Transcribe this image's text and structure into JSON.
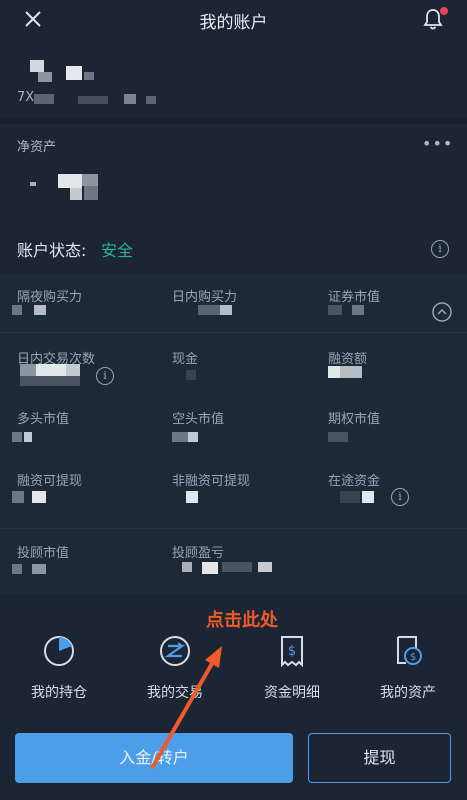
{
  "header": {
    "title": "我的账户",
    "close_icon": "close-icon",
    "bell_icon": "bell-icon"
  },
  "account": {
    "id_prefix": "7X"
  },
  "net_assets": {
    "label": "净资产",
    "more": "•••"
  },
  "status": {
    "label": "账户状态:",
    "value": "安全",
    "value_color": "#2bb39a"
  },
  "grid": {
    "row1": [
      "隔夜购买力",
      "日内购买力",
      "证券市值"
    ],
    "row2": [
      "日内交易次数",
      "现金",
      "融资额"
    ],
    "row3": [
      "多头市值",
      "空头市值",
      "期权市值"
    ],
    "row4": [
      "融资可提现",
      "非融资可提现",
      "在途资金"
    ],
    "row5": [
      "投顾市值",
      "投顾盈亏"
    ]
  },
  "hint": {
    "text": "点击此处",
    "color": "#ee5a28"
  },
  "nav": [
    {
      "label": "我的持仓",
      "icon": "pie-chart-icon"
    },
    {
      "label": "我的交易",
      "icon": "trade-icon"
    },
    {
      "label": "资金明细",
      "icon": "receipt-icon"
    },
    {
      "label": "我的资产",
      "icon": "assets-icon"
    }
  ],
  "buttons": {
    "transfer": "入金/转户",
    "withdraw": "提现"
  },
  "colors": {
    "accent": "#4d9ee8",
    "background": "#1b2533"
  }
}
